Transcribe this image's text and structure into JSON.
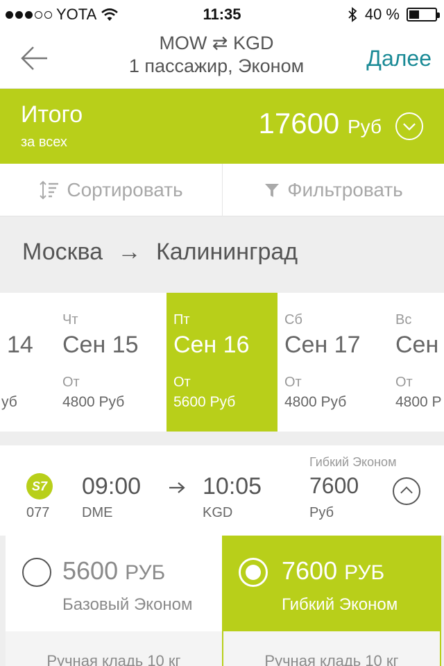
{
  "status": {
    "carrier": "YOTA",
    "time": "11:35",
    "battery": "40 %",
    "battery_level": 0.4
  },
  "nav": {
    "route": "MOW ⇄ KGD",
    "details": "1 пассажир, Эконом",
    "next_label": "Далее"
  },
  "total": {
    "label": "Итого",
    "sub": "за всех",
    "amount": "17600",
    "currency": "Руб"
  },
  "tools": {
    "sort_label": "Сортировать",
    "filter_label": "Фильтровать"
  },
  "route": {
    "from": "Москва",
    "arrow": "→",
    "to": "Калининград"
  },
  "dates": [
    {
      "dow": "",
      "date": "14",
      "from": "",
      "price": "уб"
    },
    {
      "dow": "Чт",
      "date": "Сен 15",
      "from": "От",
      "price": "4800 Руб"
    },
    {
      "dow": "Пт",
      "date": "Сен 16",
      "from": "От",
      "price": "5600 Руб"
    },
    {
      "dow": "Сб",
      "date": "Сен 17",
      "from": "От",
      "price": "4800 Руб"
    },
    {
      "dow": "Вс",
      "date": "Сен",
      "from": "От",
      "price": "4800 Р"
    }
  ],
  "flight": {
    "airline": "S7",
    "number": "077",
    "dep_time": "09:00",
    "dep_code": "DME",
    "arr_time": "10:05",
    "arr_code": "KGD",
    "fare_class": "Гибкий Эконом",
    "price": "7600",
    "currency": "Руб"
  },
  "fares": {
    "basic": {
      "amount": "5600",
      "unit": "РУБ",
      "name": "Базовый Эконом",
      "line": "Ручная кладь 10 кг"
    },
    "flex": {
      "amount": "7600",
      "unit": "РУБ",
      "name": "Гибкий Эконом",
      "line": "Ручная кладь 10 кг"
    }
  },
  "colors": {
    "accent": "#b8cf1a",
    "link": "#1a8a96"
  }
}
